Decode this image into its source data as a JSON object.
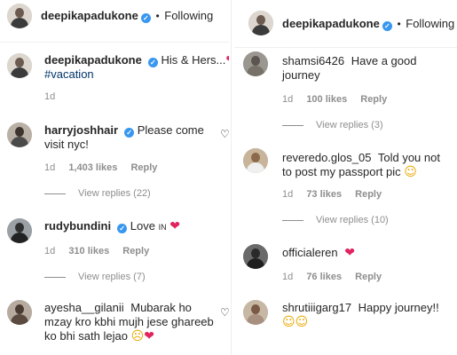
{
  "left": {
    "header": {
      "username": "deepikapadukone",
      "dot": "•",
      "following": "Following"
    },
    "caption": {
      "username": "deepikapadukone",
      "text": "His & Hers...",
      "emoji": "❤",
      "hashtag": "#vacation",
      "time": "1d"
    },
    "comments": [
      {
        "username": "harryjoshhair",
        "verified": true,
        "text_line1": "Please come",
        "text_line2": "visit nyc!",
        "time": "1d",
        "likes": "1,403 likes",
        "reply": "Reply",
        "view_replies": "View replies (22)"
      },
      {
        "username": "rudybundini",
        "verified": true,
        "text_line1": "Love",
        "text_suffix": "IN",
        "emoji": "❤",
        "time": "1d",
        "likes": "310 likes",
        "reply": "Reply",
        "view_replies": "View replies (7)"
      },
      {
        "username": "ayesha__gilanii",
        "verified": false,
        "text_line1": "Mubarak ho",
        "text_line2": "mzay kro kbhi mujh jese ghareeb",
        "text_line3": "ko bhi sath lejao",
        "emoji1": "☹",
        "emoji2": "❤"
      }
    ]
  },
  "right": {
    "header": {
      "username": "deepikapadukone",
      "dot": "•",
      "following": "Following"
    },
    "comments": [
      {
        "username": "shamsi6426",
        "text_line1": "Have a good",
        "text_line2": "journey",
        "time": "1d",
        "likes": "100 likes",
        "reply": "Reply",
        "view_replies": "View replies (3)"
      },
      {
        "username": "reveredo.glos_05",
        "text_line1": "Told you not",
        "text_line2": "to post my passport pic",
        "emoji": "☺",
        "time": "1d",
        "likes": "73 likes",
        "reply": "Reply",
        "view_replies": "View replies (10)"
      },
      {
        "username": "officialeren",
        "emoji": "❤",
        "time": "1d",
        "likes": "76 likes",
        "reply": "Reply"
      },
      {
        "username": "shrutiiigarg17",
        "text_line1": "Happy journey!!",
        "emoji1": "☺",
        "emoji2": "☺"
      }
    ]
  },
  "icons": {
    "heart_outline": "♡",
    "verified_check": "✓"
  }
}
